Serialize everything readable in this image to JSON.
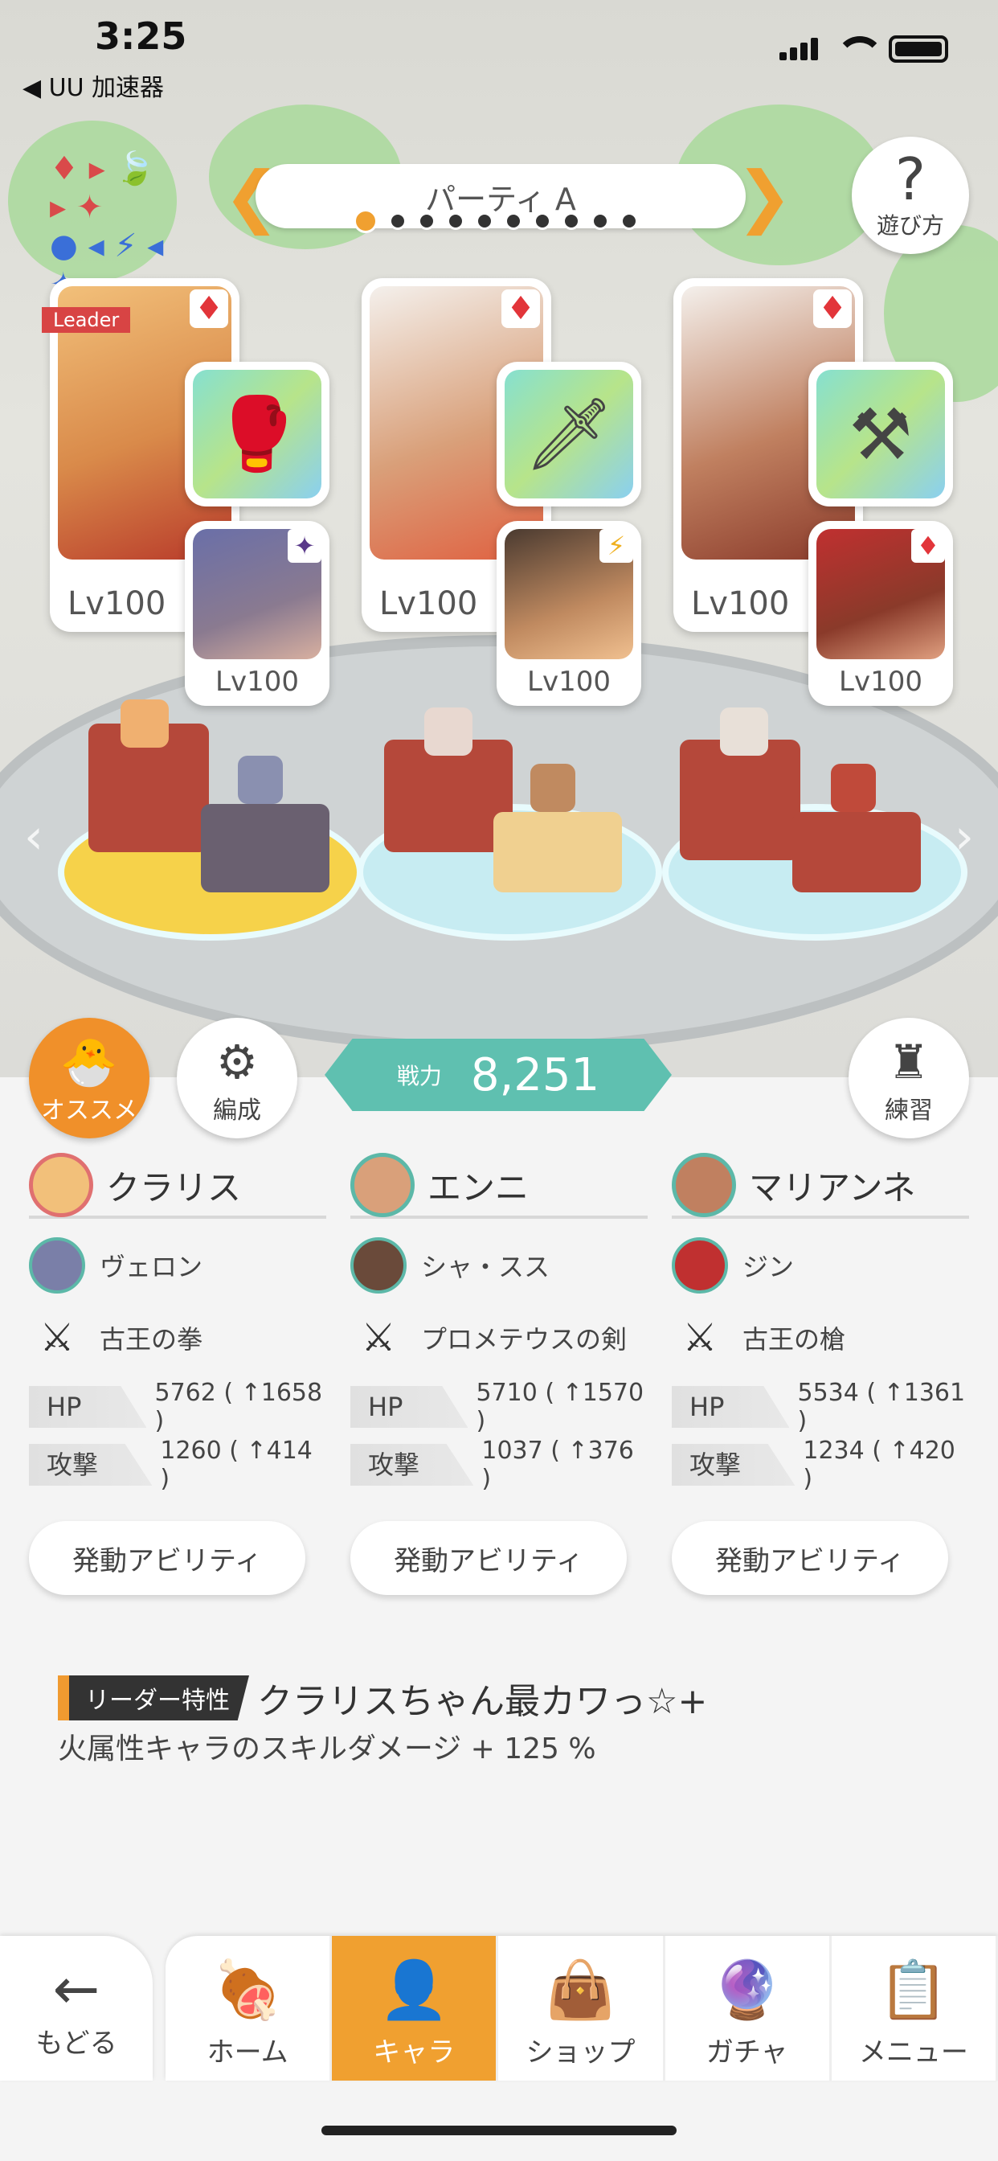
{
  "status_bar": {
    "time": "3:25",
    "back_label": "◀ UU 加速器"
  },
  "header": {
    "party_name": "パーティ A",
    "help_label": "遊び方"
  },
  "icons": {
    "help": "question-icon",
    "recommend": "recommend-icon",
    "formation": "formation-icon",
    "practice": "practice-icon",
    "back": "back-arrow-icon"
  },
  "elements_legend": {
    "row1": "♦ ▸ 🍃 ▸ ✦",
    "row2": "● ◂ ⚡ ◂ ✦"
  },
  "slots": [
    {
      "leader_label": "Leader",
      "main_level": "Lv100",
      "sub_level": "Lv100",
      "main_suit": "♦",
      "sub_suit": "✦"
    },
    {
      "main_level": "Lv100",
      "sub_level": "Lv100",
      "main_suit": "♦",
      "sub_suit": "⚡"
    },
    {
      "main_level": "Lv100",
      "sub_level": "Lv100",
      "main_suit": "♦",
      "sub_suit": "♦"
    }
  ],
  "actions": {
    "recommend_label": "オススメ",
    "formation_label": "編成",
    "practice_label": "練習"
  },
  "power": {
    "label": "戦力",
    "value": "8,251"
  },
  "columns": [
    {
      "main": "クラリス",
      "sub": "ヴェロン",
      "weapon": "古王の拳",
      "hp_label": "HP",
      "hp": "5762 ( ↑1658 )",
      "atk_label": "攻撃",
      "atk": "1260 ( ↑414 )",
      "ability": "発動アビリティ"
    },
    {
      "main": "エンニ",
      "sub": "シャ・スス",
      "weapon": "プロメテウスの剣",
      "hp_label": "HP",
      "hp": "5710 ( ↑1570 )",
      "atk_label": "攻撃",
      "atk": "1037 ( ↑376 )",
      "ability": "発動アビリティ"
    },
    {
      "main": "マリアンネ",
      "sub": "ジン",
      "weapon": "古王の槍",
      "hp_label": "HP",
      "hp": "5534 ( ↑1361 )",
      "atk_label": "攻撃",
      "atk": "1234 ( ↑420 )",
      "ability": "発動アビリティ"
    }
  ],
  "leader_skill": {
    "tag": "リーダー特性",
    "name": "クラリスちゃん最カワっ☆+",
    "description": "火属性キャラのスキルダメージ + 125 %"
  },
  "bottom_nav": {
    "back_label": "もどる",
    "tabs": [
      "ホーム",
      "キャラ",
      "ショップ",
      "ガチャ",
      "メニュー"
    ],
    "active_tab": "キャラ"
  },
  "colors": {
    "accent": "#f0a030",
    "power": "#5fc0b0",
    "fire": "#e2353a"
  }
}
